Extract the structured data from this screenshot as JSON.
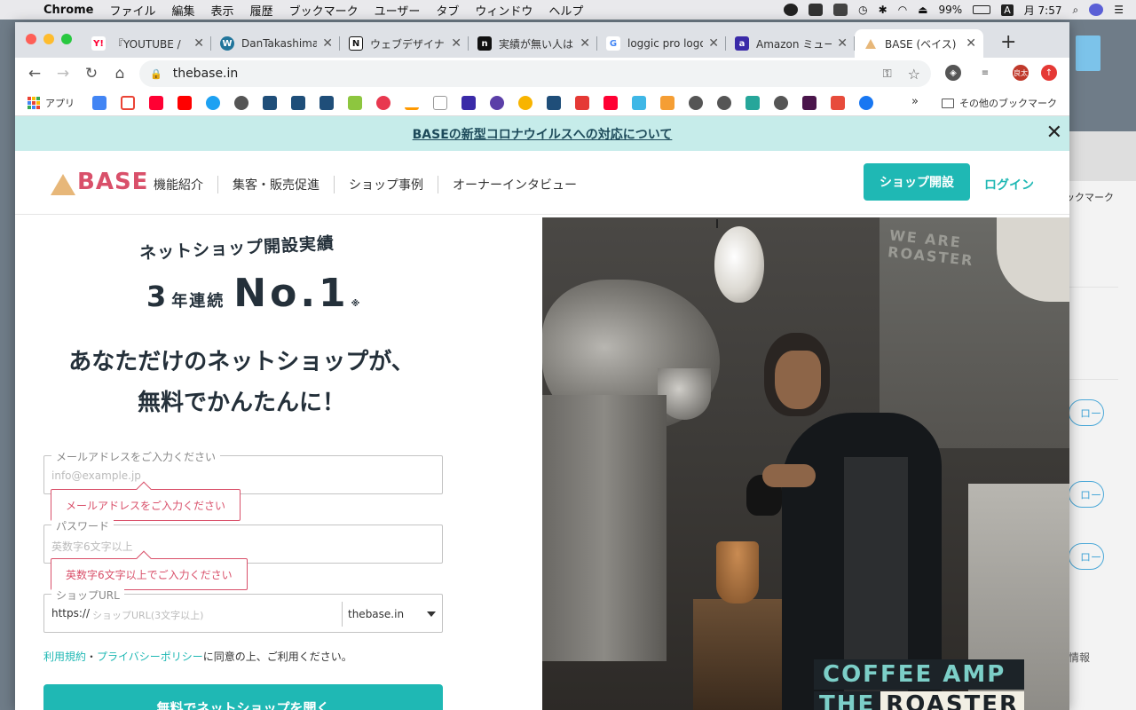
{
  "menubar": {
    "app": "Chrome",
    "items": [
      "ファイル",
      "編集",
      "表示",
      "履歴",
      "ブックマーク",
      "ユーザー",
      "タブ",
      "ウィンドウ",
      "ヘルプ"
    ],
    "battery": "99%",
    "input_mode": "A",
    "clock": "月 7:57"
  },
  "tabs": [
    {
      "title": "『YOUTUBE /",
      "favicon": "yahoo-icon",
      "color": "#ff0033"
    },
    {
      "title": "DanTakashima",
      "favicon": "wordpress-icon",
      "color": "#21759b"
    },
    {
      "title": "ウェブデザイナー",
      "favicon": "notion-icon",
      "color": "#111111"
    },
    {
      "title": "実績が無い人は",
      "favicon": "note-icon",
      "color": "#111111"
    },
    {
      "title": "loggic pro logo",
      "favicon": "google-icon",
      "color": "#4285f4"
    },
    {
      "title": "Amazon ミュー",
      "favicon": "amazon-music-icon",
      "color": "#3a2aa8"
    },
    {
      "title": "BASE (ベイス)",
      "favicon": "base-icon",
      "color": "#e7b779"
    }
  ],
  "omnibox": {
    "url": "thebase.in"
  },
  "extensions": {
    "profile_label": "良太"
  },
  "bookmarks": {
    "apps_label": "アプリ",
    "other_label": "その他のブックマーク",
    "more": "»",
    "icons": [
      "calendar-icon",
      "gmail-icon",
      "yahoo-icon",
      "youtube-icon",
      "twitter-icon",
      "globe-icon",
      "sns-icon",
      "base-top-icon",
      "base-top-icon",
      "n-icon",
      "flower-icon",
      "amazon-icon",
      "wikipedia-icon",
      "chart-icon",
      "circle-icon",
      "timer-icon",
      "base-top-icon",
      "red-box-icon",
      "paypay-icon",
      "triangle-icon",
      "box-icon",
      "globe-icon",
      "globe-icon",
      "bird-icon",
      "globe-icon",
      "slack-icon",
      "bird2-icon",
      "f-icon"
    ]
  },
  "site": {
    "banner": "BASEの新型コロナウイルスへの対応について",
    "logo": "BASE",
    "nav": [
      "機能紹介",
      "集客・販売促進",
      "ショップ事例",
      "オーナーインタビュー"
    ],
    "cta": "ショップ開設",
    "login": "ログイン",
    "kicker": "ネットショップ開設実績",
    "award_num": "3",
    "award_text": "年連続",
    "award_big": "No.1",
    "award_note": "※",
    "headline_1": "あなただけのネットショップが、",
    "headline_2": "無料でかんたんに！",
    "email_label": "メールアドレスをご入力ください",
    "email_placeholder": "info@example.jp",
    "email_error": "メールアドレスをご入力ください",
    "password_label": "パスワード",
    "password_placeholder": "英数字6文字以上",
    "password_error": "英数字6文字以上でご入力ください",
    "shopurl_label": "ショップURL",
    "shopurl_prefix": "https://",
    "shopurl_placeholder": "ショップURL(3文字以上)",
    "shopurl_domain": "thebase.in",
    "terms_link1": "利用規約",
    "terms_sep": "・",
    "terms_link2": "プライバシーポリシー",
    "terms_rest": "に同意の上、ご利用ください。",
    "submit": "無料でネットショップを開く",
    "photo_sign_1": "COFFEE AMP",
    "photo_sign_2a": "THE",
    "photo_sign_2b": "ROASTER",
    "photo_wall_text": "WE ARE ROASTER"
  },
  "background_window": {
    "buttons": [
      "ロー",
      "ロー",
      "ロー"
    ],
    "info": "情報",
    "bookmarks_partial": "ックマーク"
  }
}
